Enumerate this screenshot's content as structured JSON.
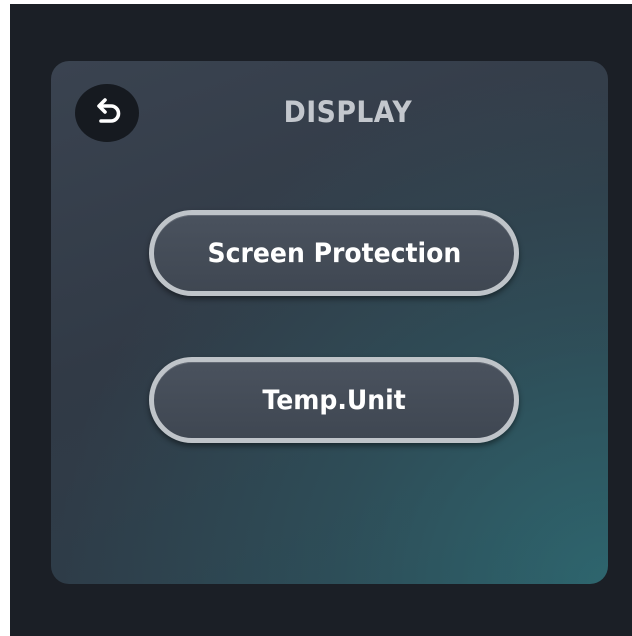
{
  "display_menu": {
    "title": "DISPLAY",
    "back_icon": "undo-arrow-icon",
    "buttons": [
      {
        "label": "Screen Protection"
      },
      {
        "label": "Temp.Unit"
      }
    ]
  },
  "colors": {
    "screen_background": "#1b1f26",
    "card_background": "#353d49",
    "card_accent_teal": "#2e6c74",
    "button_border": "#bfc4c9",
    "button_fill": "#454d58",
    "title_text": "#c3c7cd",
    "button_text": "#ffffff"
  }
}
